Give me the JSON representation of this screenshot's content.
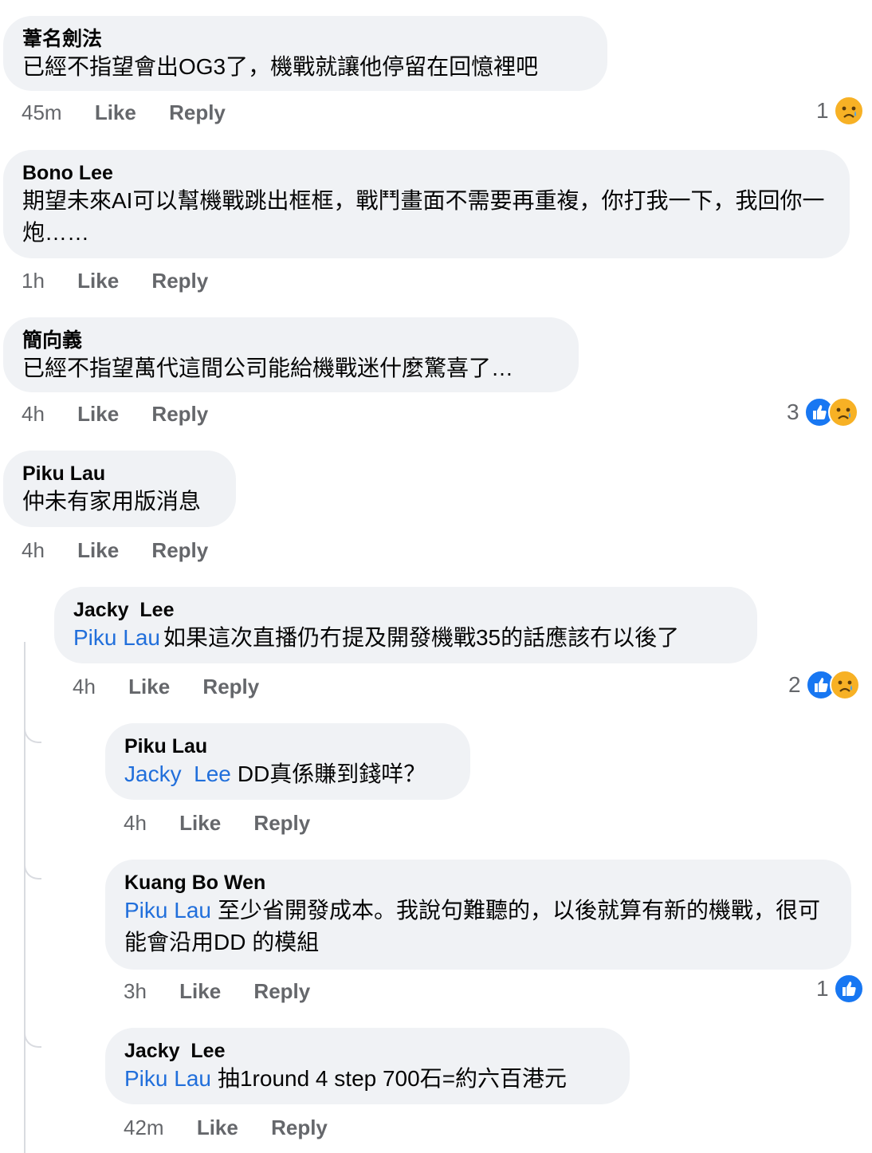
{
  "comments": [
    {
      "author": "葦名劍法",
      "text": "已經不指望會出OG3了，機戰就讓他停留在回憶裡吧",
      "time": "45m",
      "like_label": "Like",
      "reply_label": "Reply",
      "reaction_count": "1",
      "reaction_icons": [
        "sad-icon"
      ]
    },
    {
      "author": "Bono Lee",
      "text": "期望未來AI可以幫機戰跳出框框，戰鬥畫面不需要再重複，你打我一下，我回你一炮……",
      "time": "1h",
      "like_label": "Like",
      "reply_label": "Reply"
    },
    {
      "author": "簡向義",
      "text": "已經不指望萬代這間公司能給機戰迷什麼驚喜了…",
      "time": "4h",
      "like_label": "Like",
      "reply_label": "Reply",
      "reaction_count": "3",
      "reaction_icons": [
        "like-icon",
        "sad-icon"
      ]
    },
    {
      "author": "Piku Lau",
      "text": "仲未有家用版消息",
      "time": "4h",
      "like_label": "Like",
      "reply_label": "Reply"
    }
  ],
  "replies": [
    {
      "author": "Jacky  Lee",
      "mention": "Piku Lau",
      "text": "如果這次直播仍冇提及開發機戰35的話應該冇以後了",
      "time": "4h",
      "like_label": "Like",
      "reply_label": "Reply",
      "reaction_count": "2",
      "reaction_icons": [
        "like-icon",
        "sad-icon"
      ]
    },
    {
      "author": "Piku Lau",
      "mention": "Jacky  Lee",
      "text": "DD真係賺到錢咩？",
      "time": "4h",
      "like_label": "Like",
      "reply_label": "Reply"
    },
    {
      "author": "Kuang Bo Wen",
      "mention": "Piku Lau",
      "text": "至少省開發成本。我說句難聽的，以後就算有新的機戰，很可能會沿用DD 的模組",
      "time": "3h",
      "like_label": "Like",
      "reply_label": "Reply",
      "reaction_count": "1",
      "reaction_icons": [
        "like-icon"
      ]
    },
    {
      "author": "Jacky  Lee",
      "mention": "Piku Lau",
      "text": "抽1round 4 step 700石=約六百港元",
      "time": "42m",
      "like_label": "Like",
      "reply_label": "Reply"
    }
  ],
  "colors": {
    "bubble": "#f0f2f5",
    "mention": "#216fdb",
    "like": "#1877f2",
    "sad": "#f7b125",
    "meta": "#65676b"
  }
}
